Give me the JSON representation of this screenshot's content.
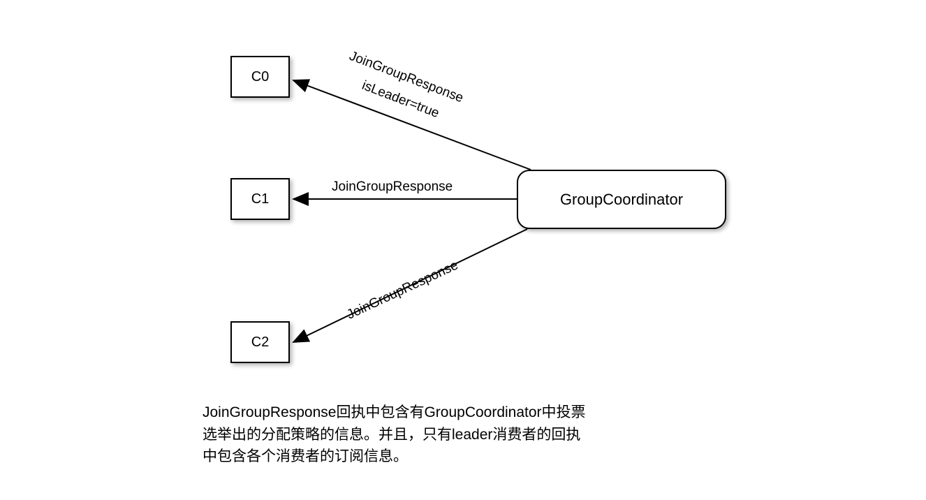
{
  "nodes": {
    "c0": "C0",
    "c1": "C1",
    "c2": "C2",
    "coordinator": "GroupCoordinator"
  },
  "edges": {
    "to_c0_line1": "JoinGroupResponse",
    "to_c0_line2": "isLeader=true",
    "to_c1": "JoinGroupResponse",
    "to_c2": "JoinGroupResponse"
  },
  "caption": "JoinGroupResponse回执中包含有GroupCoordinator中投票选举出的分配策略的信息。并且，只有leader消费者的回执中包含各个消费者的订阅信息。"
}
